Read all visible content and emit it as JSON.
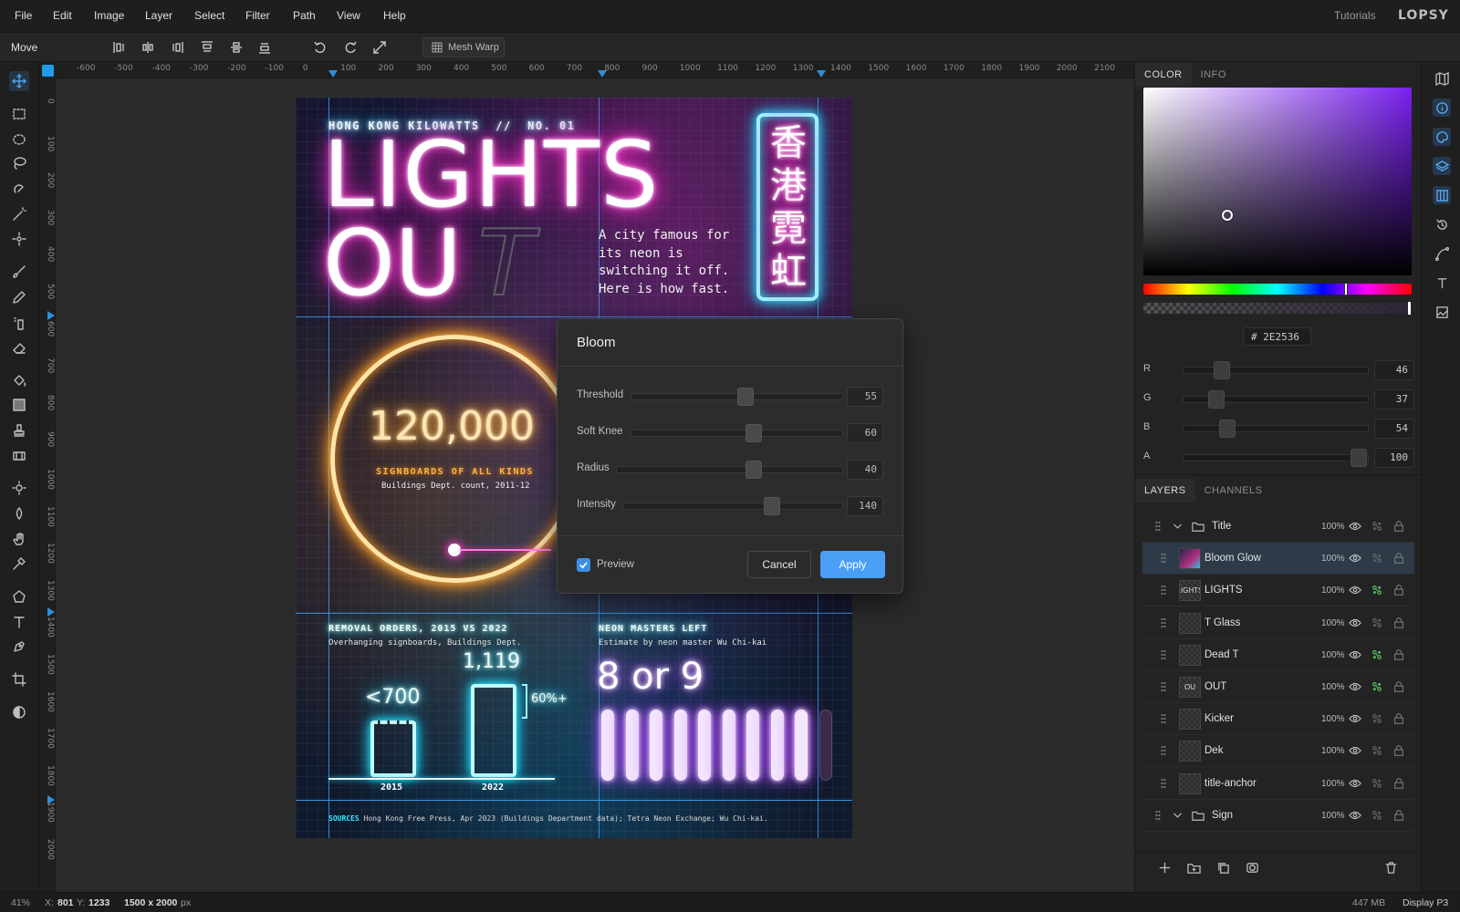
{
  "app": {
    "brand": "LOPSY",
    "tutorials": "Tutorials"
  },
  "menu": [
    "File",
    "Edit",
    "Image",
    "Layer",
    "Select",
    "Filter",
    "Path",
    "View",
    "Help"
  ],
  "options": {
    "tool_name": "Move",
    "mesh_warp": "Mesh Warp"
  },
  "rulers": {
    "h_ticks": [
      "-600",
      "-500",
      "-400",
      "-300",
      "-200",
      "-100",
      "0",
      "100",
      "200",
      "300",
      "400",
      "500",
      "600",
      "700",
      "800",
      "900",
      "1000",
      "1100",
      "1200",
      "1300",
      "1400",
      "1500",
      "1600",
      "1700",
      "1800",
      "1900",
      "2000",
      "2100"
    ],
    "v_ticks": [
      "0",
      "100",
      "200",
      "300",
      "400",
      "500",
      "600",
      "700",
      "800",
      "900",
      "1000",
      "1100",
      "1200",
      "1300",
      "1400",
      "1500",
      "1600",
      "1700",
      "1800",
      "1900",
      "2000"
    ]
  },
  "poster": {
    "kicker": "HONG KONG KILOWATTS  //  NO. 01",
    "title_line1": "LIGHTS",
    "title_line2": "OU",
    "title_dead": "T",
    "dek": "A city famous for its neon is switching it off. Here is how fast.",
    "sign_chars": [
      "香",
      "港",
      "霓",
      "虹"
    ],
    "big_number": "120,000",
    "big_label": "SIGNBOARDS OF ALL KINDS",
    "big_source": "Buildings Dept. count, 2011-12",
    "removal_title": "REMOVAL ORDERS, 2015 VS 2022",
    "removal_sub": "Overhanging signboards, Buildings Dept.",
    "bar_2015_value": "<700",
    "bar_2022_value": "1,119",
    "bar_change": "60%+",
    "bar_2015_label": "2015",
    "bar_2022_label": "2022",
    "masters_title": "NEON MASTERS LEFT",
    "masters_sub": "Estimate by neon master Wu Chi-kai",
    "masters_value": "8 or 9",
    "tubes_lit": 9,
    "tubes_dim": 1,
    "sources_label": "SOURCES",
    "sources_text": "Hong Kong Free Press, Apr 2023 (Buildings Department data); Tetra Neon Exchange; Wu Chi-kai."
  },
  "bloom_dialog": {
    "title": "Bloom",
    "sliders": [
      {
        "label": "Threshold",
        "value": "55",
        "fraction": 0.55
      },
      {
        "label": "Soft Knee",
        "value": "60",
        "fraction": 0.6
      },
      {
        "label": "Radius",
        "value": "40",
        "fraction": 0.6
      },
      {
        "label": "Intensity",
        "value": "140",
        "fraction": 0.7
      }
    ],
    "preview_label": "Preview",
    "preview_checked": true,
    "cancel": "Cancel",
    "apply": "Apply"
  },
  "color_panel": {
    "tabs": [
      "COLOR",
      "INFO"
    ],
    "hex_prefix": "#",
    "hex": "2E2536",
    "channels": [
      {
        "label": "R",
        "value": "46"
      },
      {
        "label": "G",
        "value": "37"
      },
      {
        "label": "B",
        "value": "54"
      },
      {
        "label": "A",
        "value": "100"
      }
    ],
    "accent": "#4a9ff5"
  },
  "layers_panel": {
    "tabs": [
      "LAYERS",
      "CHANNELS"
    ],
    "layers": [
      {
        "name": "Title",
        "opacity": "100%",
        "group": true,
        "fx": false
      },
      {
        "name": "Bloom Glow",
        "opacity": "100%",
        "selected": true,
        "fx": false
      },
      {
        "name": "LIGHTS",
        "opacity": "100%",
        "fx": true,
        "thumb": "LIGHTS"
      },
      {
        "name": "T Glass",
        "opacity": "100%",
        "fx": false
      },
      {
        "name": "Dead T",
        "opacity": "100%",
        "fx": true
      },
      {
        "name": "OUT",
        "opacity": "100%",
        "fx": true,
        "thumb": "OU"
      },
      {
        "name": "Kicker",
        "opacity": "100%",
        "fx": false
      },
      {
        "name": "Dek",
        "opacity": "100%",
        "fx": false
      },
      {
        "name": "title-anchor",
        "opacity": "100%",
        "fx": false
      },
      {
        "name": "Sign",
        "opacity": "100%",
        "group": true,
        "fx": false
      }
    ]
  },
  "status": {
    "zoom": "41%",
    "x_label": "X:",
    "x": "801",
    "y_label": "Y:",
    "y": "1233",
    "doc_size": "1500 x 2000",
    "doc_unit": "px",
    "memory": "447 MB",
    "profile": "Display P3"
  }
}
